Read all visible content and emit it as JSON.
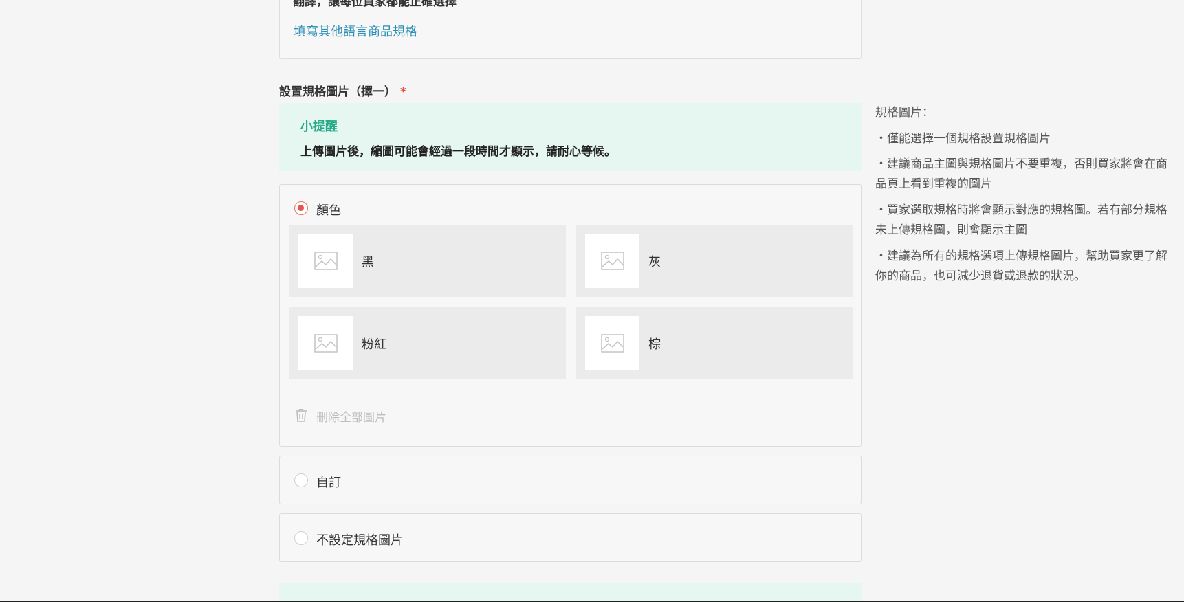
{
  "top_card": {
    "cut_text": "翻譯，讓每位買家都能正確選擇",
    "link_label": "填寫其他語言商品規格"
  },
  "section": {
    "title": "設置規格圖片（擇一）",
    "required_mark": "*"
  },
  "tip": {
    "title": "小提醒",
    "text": "上傳圖片後，縮圖可能會經過一段時間才顯示，請耐心等候。"
  },
  "options": {
    "color": {
      "label": "顏色",
      "selected": true,
      "variants": [
        {
          "label": "黑",
          "icon": "image-placeholder-icon"
        },
        {
          "label": "灰",
          "icon": "image-placeholder-icon"
        },
        {
          "label": "粉紅",
          "icon": "image-placeholder-icon"
        },
        {
          "label": "棕",
          "icon": "image-placeholder-icon"
        }
      ],
      "delete_all_label": "刪除全部圖片"
    },
    "custom": {
      "label": "自訂",
      "selected": false
    },
    "none": {
      "label": "不設定規格圖片",
      "selected": false
    }
  },
  "side_help": {
    "title": "規格圖片：",
    "items": [
      "僅能選擇一個規格設置規格圖片",
      "建議商品主圖與規格圖片不要重複，否則買家將會在商品頁上看到重複的圖片",
      "買家選取規格時將會顯示對應的規格圖。若有部分規格未上傳規格圖，則會顯示主圖",
      "建議為所有的規格選項上傳規格圖片，幫助買家更了解你的商品，也可減少退貨或退款的狀況。"
    ]
  },
  "colors": {
    "accent_teal": "#26aa87",
    "tip_background": "#e6f7f1",
    "link_blue": "#2b8fb4",
    "radio_red": "#e8534a",
    "required_red": "#e84a3e"
  }
}
